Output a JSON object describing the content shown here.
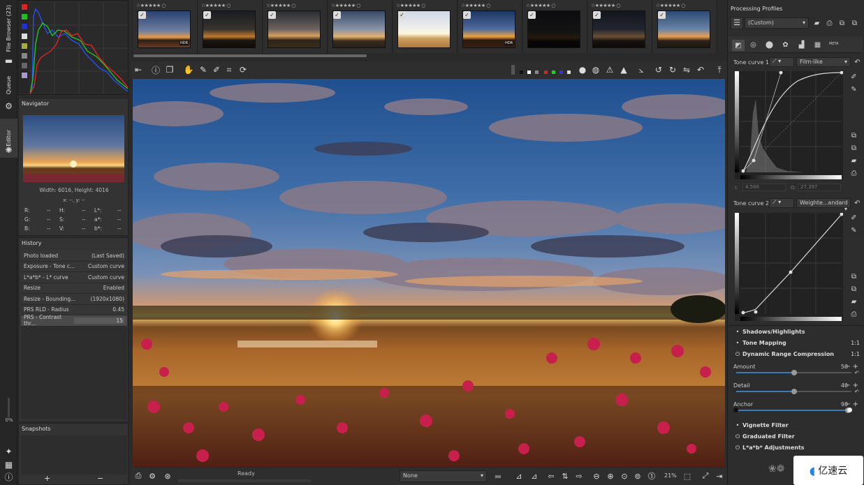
{
  "left_tabs": {
    "file_browser": "File Browser (23)",
    "queue": "Queue",
    "editor": "Editor",
    "progress": "0%"
  },
  "navigator": {
    "title": "Navigator",
    "dimensions": "Width: 6016, Height: 4016",
    "coords": "x: --, y: --",
    "readouts": [
      {
        "l1": "R:",
        "v1": "--",
        "l2": "H:",
        "v2": "--",
        "l3": "L*:",
        "v3": "--"
      },
      {
        "l1": "G:",
        "v1": "--",
        "l2": "S:",
        "v2": "--",
        "l3": "a*:",
        "v3": "--"
      },
      {
        "l1": "B:",
        "v1": "--",
        "l2": "V:",
        "v2": "--",
        "l3": "b*:",
        "v3": "--"
      }
    ]
  },
  "history": {
    "title": "History",
    "rows": [
      {
        "action": "Photo loaded",
        "value": "(Last Saved)"
      },
      {
        "action": "Exposure - Tone c...",
        "value": "Custom curve"
      },
      {
        "action": "L*a*b* - L* curve",
        "value": "Custom curve"
      },
      {
        "action": "Resize",
        "value": "Enabled"
      },
      {
        "action": "Resize - Bounding...",
        "value": "(1920x1080)"
      },
      {
        "action": "PRS RLD - Radius",
        "value": "0.45"
      },
      {
        "action": "PRS - Contrast thr...",
        "value": "15"
      }
    ]
  },
  "snapshots": {
    "title": "Snapshots",
    "add": "+",
    "remove": "−"
  },
  "filmstrip": [
    {
      "stars": "☆★★★★★ ○",
      "hdr": "HDR",
      "checked": true
    },
    {
      "stars": "☆★★★★★ ○",
      "hdr": "",
      "checked": true
    },
    {
      "stars": "☆★★★★★ ○",
      "hdr": "",
      "checked": true
    },
    {
      "stars": "☆★★★★★ ○",
      "hdr": "",
      "checked": true
    },
    {
      "stars": "☆★★★★★ ○",
      "hdr": "",
      "checked": true
    },
    {
      "stars": "☆★★★★★ ○",
      "hdr": "HDR",
      "checked": true
    },
    {
      "stars": "☆★★★★★ ○",
      "hdr": "",
      "checked": true
    },
    {
      "stars": "☆★★★★★ ○",
      "hdr": "",
      "checked": true
    },
    {
      "stars": "☆★★★★★ ○",
      "hdr": "",
      "checked": true
    }
  ],
  "status": {
    "text": "Ready",
    "zoom": "21%",
    "profile_select": "None"
  },
  "right": {
    "processing_profiles_title": "Processing Profiles",
    "profile_value": "(Custom)",
    "tone_curve_1": {
      "label": "Tone curve 1:",
      "mode": "Film-like",
      "in_label": "I:",
      "in_value": "4.566",
      "out_label": "O:",
      "out_value": "27.397"
    },
    "tone_curve_2": {
      "label": "Tone curve 2:",
      "mode": "Weighte...andard"
    },
    "sections": {
      "shadows": "Shadows/Highlights",
      "tone_mapping": "Tone Mapping",
      "drc": "Dynamic Range Compression",
      "vignette": "Vignette Filter",
      "graduated": "Graduated Filter",
      "lab": "L*a*b* Adjustments",
      "ratio": "1:1"
    },
    "drc_params": [
      {
        "label": "Amount",
        "value": "50",
        "fraction": 0.5
      },
      {
        "label": "Detail",
        "value": "40",
        "fraction": 0.5
      },
      {
        "label": "Anchor",
        "value": "98",
        "fraction": 0.97
      }
    ]
  },
  "watermark": {
    "text": "亿速云"
  },
  "colors": {
    "accent": "#3d7ab8",
    "bg": "#2b2b2b",
    "panel": "#333333"
  }
}
